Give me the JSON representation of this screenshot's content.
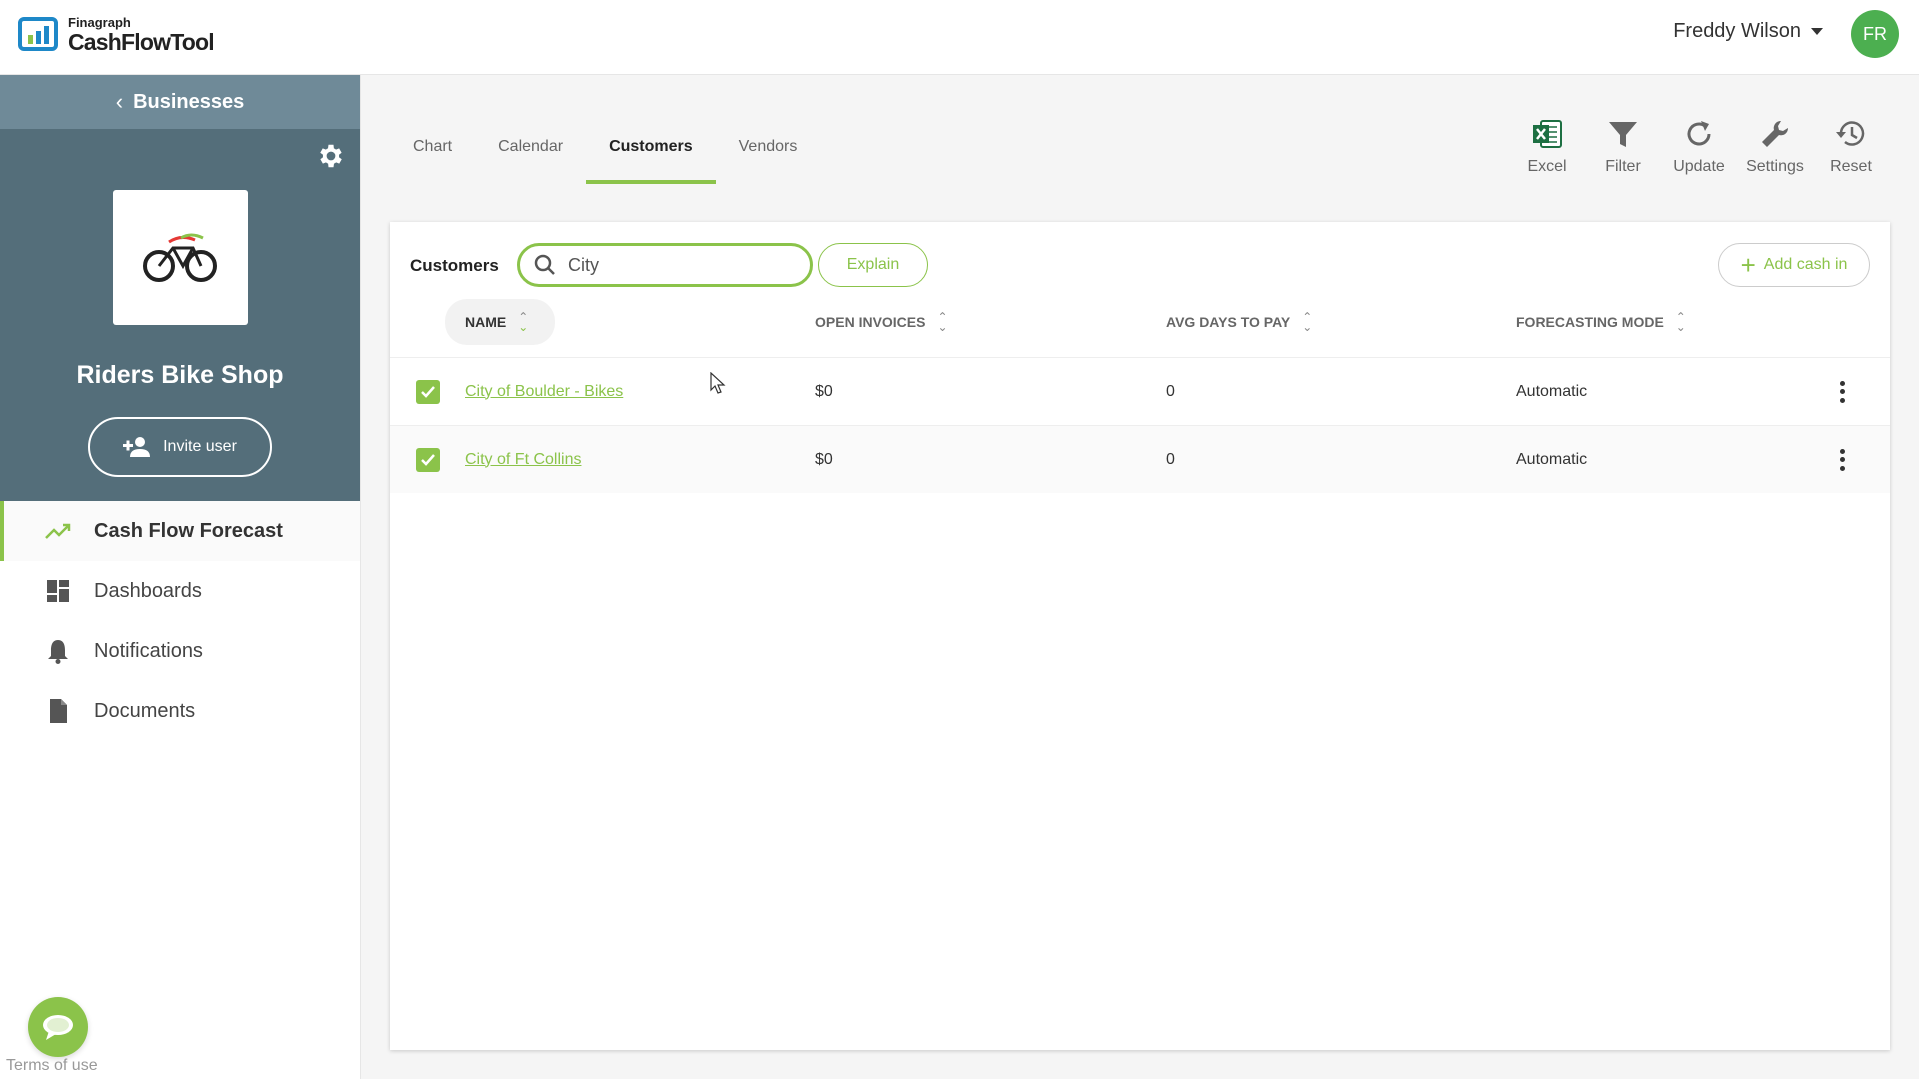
{
  "app": {
    "logo_small": "Finagraph",
    "logo_big": "CashFlowTool",
    "user_name": "Freddy Wilson",
    "user_initials": "FR"
  },
  "sidebar": {
    "back_label": "Businesses",
    "business_name": "Riders Bike Shop",
    "invite_label": "Invite user",
    "nav": [
      {
        "label": "Cash Flow Forecast",
        "icon": "trending-up-icon",
        "active": true
      },
      {
        "label": "Dashboards",
        "icon": "dashboard-icon",
        "active": false
      },
      {
        "label": "Notifications",
        "icon": "bell-icon",
        "active": false
      },
      {
        "label": "Documents",
        "icon": "document-icon",
        "active": false
      }
    ],
    "terms": "Terms of use"
  },
  "tabs": [
    {
      "label": "Chart",
      "active": false
    },
    {
      "label": "Calendar",
      "active": false
    },
    {
      "label": "Customers",
      "active": true
    },
    {
      "label": "Vendors",
      "active": false
    }
  ],
  "toolbar": [
    {
      "label": "Excel",
      "icon": "excel-icon"
    },
    {
      "label": "Filter",
      "icon": "filter-icon"
    },
    {
      "label": "Update",
      "icon": "refresh-icon"
    },
    {
      "label": "Settings",
      "icon": "wrench-icon"
    },
    {
      "label": "Reset",
      "icon": "history-icon"
    }
  ],
  "customers": {
    "title": "Customers",
    "search_value": "City",
    "explain_label": "Explain",
    "add_cash_label": "Add cash in",
    "columns": [
      "NAME",
      "OPEN INVOICES",
      "AVG DAYS TO PAY",
      "FORECASTING MODE"
    ],
    "rows": [
      {
        "name": "City of Boulder - Bikes",
        "open_invoices": "$0",
        "avg_days": "0",
        "mode": "Automatic",
        "checked": true
      },
      {
        "name": "City of Ft Collins",
        "open_invoices": "$0",
        "avg_days": "0",
        "mode": "Automatic",
        "checked": true
      }
    ]
  },
  "colors": {
    "accent": "#8bc34a",
    "sidebar_panel": "#546e7a",
    "sidebar_header": "#6f8a98",
    "avatar": "#4caf50"
  }
}
